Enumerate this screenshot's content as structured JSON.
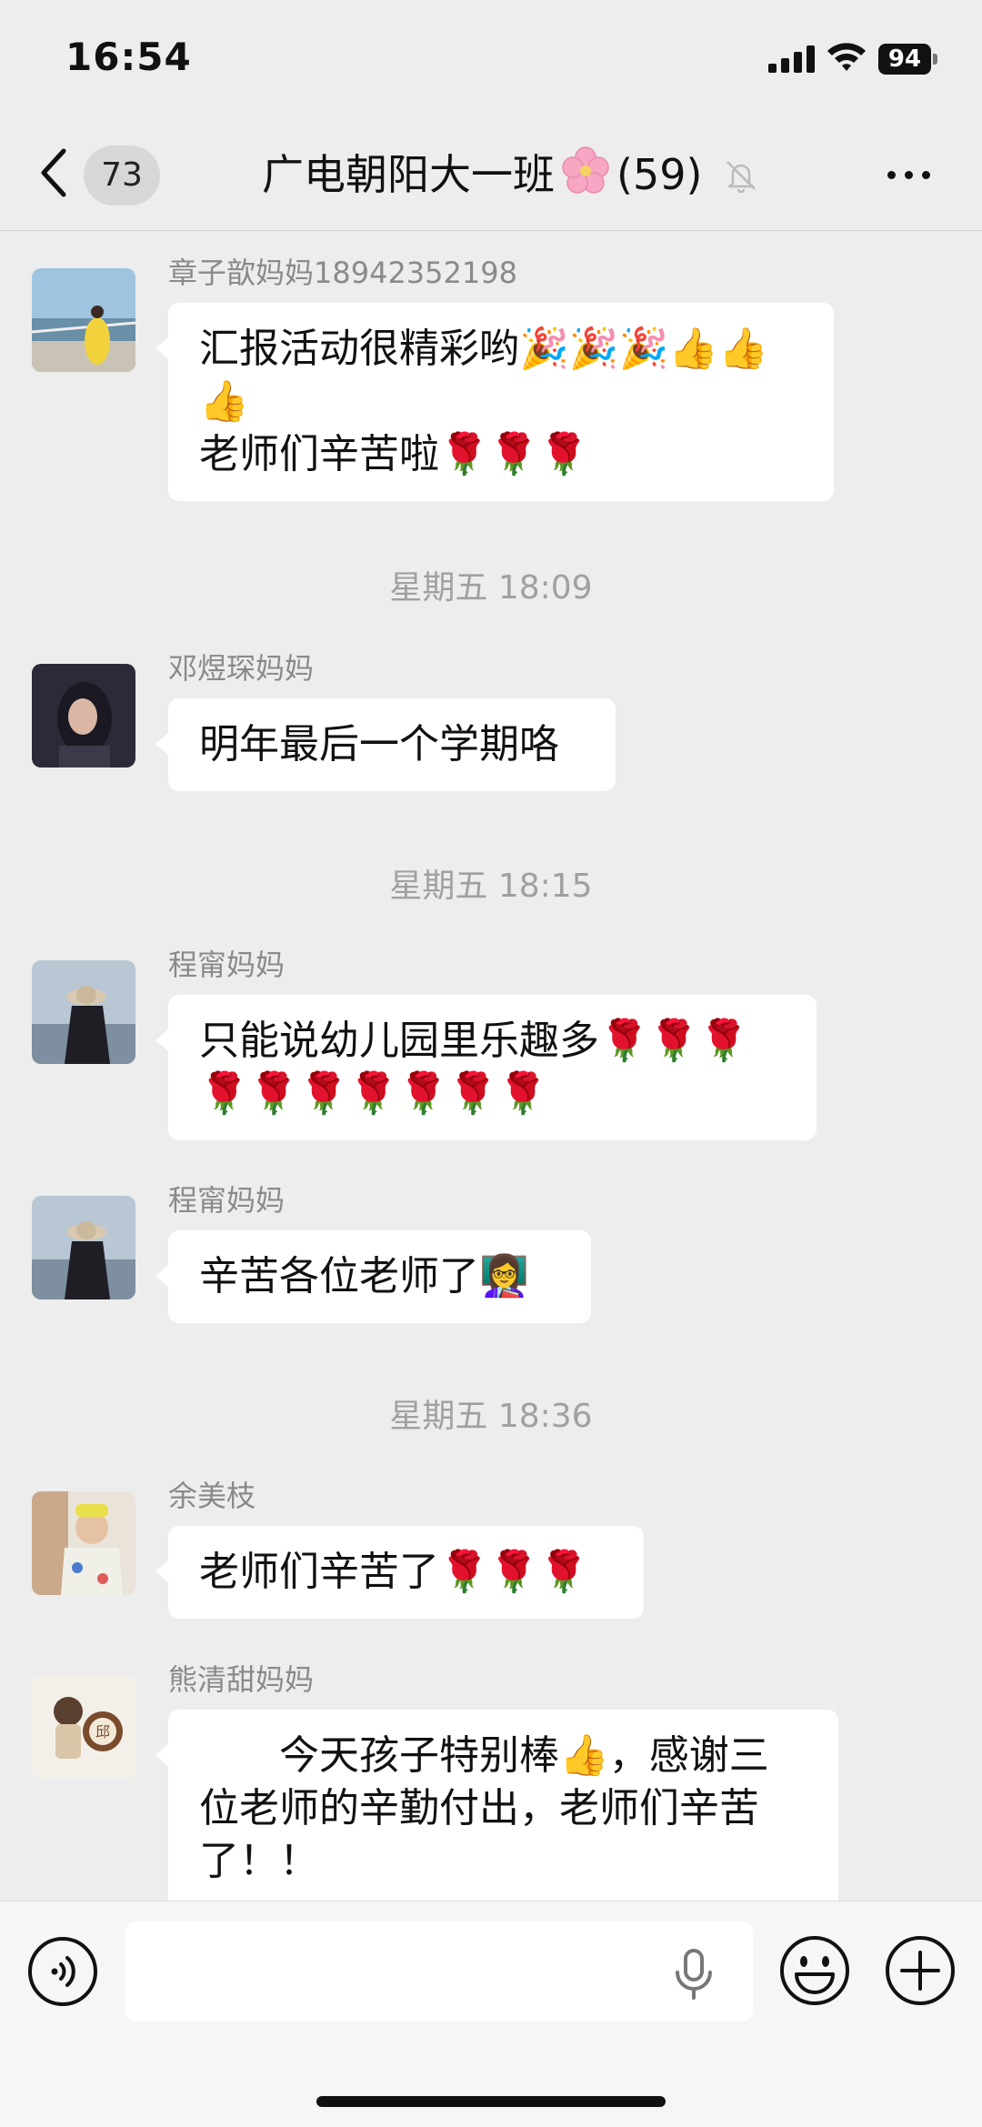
{
  "status_bar": {
    "time": "16:54",
    "battery": "94"
  },
  "nav": {
    "unread_count": "73",
    "title_prefix": "广电朝阳大一班",
    "title_suffix": "(59)"
  },
  "messages": [
    {
      "sender": "章子歆妈妈18942352198",
      "text": "汇报活动很精彩哟🎉🎉🎉👍👍\n👍\n老师们辛苦啦🌹🌹🌹"
    },
    {
      "timestamp": "星期五 18:09"
    },
    {
      "sender": "邓煜琛妈妈",
      "text": "明年最后一个学期咯"
    },
    {
      "timestamp": "星期五 18:15"
    },
    {
      "sender": "程甯妈妈",
      "text": "只能说幼儿园里乐趣多🌹🌹🌹\n🌹🌹🌹🌹🌹🌹🌹"
    },
    {
      "sender": "程甯妈妈",
      "text": "辛苦各位老师了👩‍🏫"
    },
    {
      "timestamp": "星期五 18:36"
    },
    {
      "sender": "余美枝",
      "text": "老师们辛苦了🌹🌹🌹"
    },
    {
      "sender": "熊清甜妈妈",
      "text": "　　今天孩子特别棒👍，感谢三\n位老师的辛勤付出，老师们辛苦\n了！！"
    }
  ],
  "icons": {
    "back": "chevron-left-icon",
    "mute": "bell-slash-icon",
    "more": "more-dots-icon",
    "voice": "voice-icon",
    "mic": "mic-icon",
    "emoji": "smiley-icon",
    "plus": "plus-icon"
  },
  "colors": {
    "background": "#ededed",
    "bubble": "#ffffff",
    "timestamp": "#a0a0a0",
    "sender": "#8a8a8a"
  }
}
